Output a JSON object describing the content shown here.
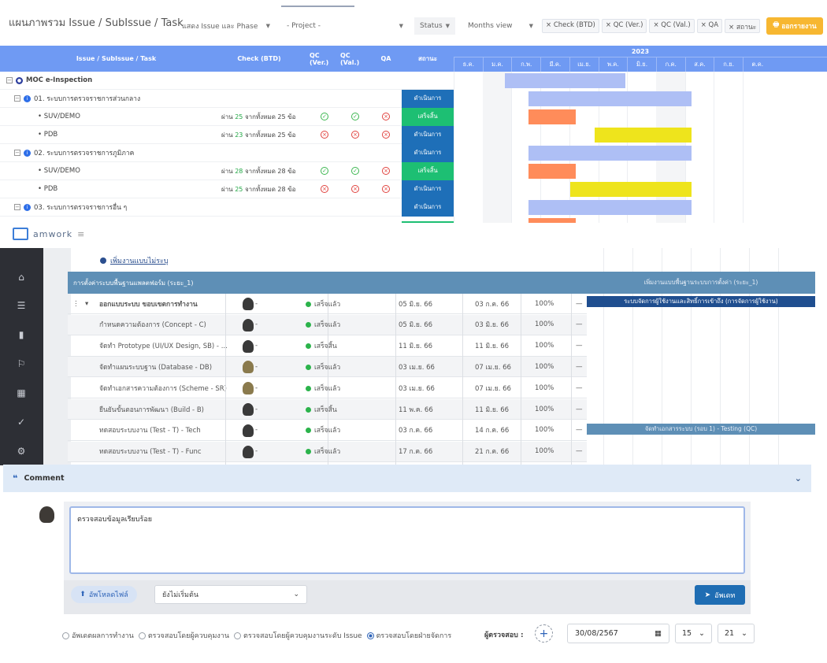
{
  "top": {
    "title": "แผนภาพรวม Issue / SubIssue / Task",
    "filters": {
      "display": "แสดง Issue และ Phase",
      "project": "- Project -",
      "status": "Status",
      "view": "Months view"
    },
    "chips": [
      "× Check (BTD)",
      "× QC (Ver.)",
      "× QC (Val.)",
      "× QA",
      "× สถานะ"
    ],
    "export_label": "ออกรายงาน",
    "columns": {
      "task": "Issue / SubIssue / Task",
      "check": "Check (BTD)",
      "qc_ver": "QC (Ver.)",
      "qc_val": "QC (Val.)",
      "qa": "QA",
      "status": "สถานะ"
    },
    "year": "2023",
    "months": [
      "ธ.ค.",
      "ม.ค.",
      "ก.พ.",
      "มี.ค.",
      "เม.ย.",
      "พ.ค.",
      "มิ.ย.",
      "ก.ค.",
      "ส.ค.",
      "ก.ย.",
      "ต.ค."
    ],
    "rows": [
      {
        "label": "MOC e-Inspection",
        "check": "",
        "status": ""
      },
      {
        "label": "01. ระบบการตรวจราชการส่วนกลาง",
        "check": "",
        "status": "ดำเนินการ"
      },
      {
        "label": "• SUV/DEMO",
        "check_pre": "ผ่าน",
        "check_num": "25",
        "check_post": "จากทั้งหมด 25 ข้อ",
        "status": "เสร็จสิ้น"
      },
      {
        "label": "• PDB",
        "check_pre": "ผ่าน",
        "check_num": "23",
        "check_post": "จากทั้งหมด 25 ข้อ",
        "status": "ดำเนินการ"
      },
      {
        "label": "02. ระบบการตรวจราชการภูมิภาค",
        "check": "",
        "status": "ดำเนินการ"
      },
      {
        "label": "• SUV/DEMO",
        "check_pre": "ผ่าน",
        "check_num": "28",
        "check_post": "จากทั้งหมด 28 ข้อ",
        "status": "เสร็จสิ้น"
      },
      {
        "label": "• PDB",
        "check_pre": "ผ่าน",
        "check_num": "25",
        "check_post": "จากทั้งหมด 28 ข้อ",
        "status": "ดำเนินการ"
      },
      {
        "label": "03. ระบบการตรวจราชการอื่น ๆ",
        "check": "",
        "status": "ดำเนินการ"
      }
    ]
  },
  "mid": {
    "logo": "amwork",
    "project_link": "เพิ่มงานแบบไม่ระบุ",
    "group_header": "การตั้งค่าระบบพื้นฐานแพลตฟอร์ม (ระยะ_1)",
    "gantt_bar_1": "เพิ่มงานแบบพื้นฐานระบบการตั้งค่า (ระยะ_1)",
    "gantt_bar_2": "ระบบจัดการผู้ใช้งานและสิทธิ์การเข้าถึง (การจัดการผู้ใช้งาน)",
    "gantt_bar_3": "จัดทำเอกสารระบบ (รอบ 1) - Testing (QC)",
    "rows": [
      {
        "name": "ออกแบบระบบ ขอบเขตการทำงาน",
        "status": "เสร็จแล้ว",
        "start": "05 มิ.ย. 66",
        "end": "03 ก.ค. 66",
        "pct": "100%"
      },
      {
        "name": "กำหนดความต้องการ (Concept - C)",
        "status": "เสร็จแล้ว",
        "start": "05 มิ.ย. 66",
        "end": "03 มิ.ย. 66",
        "pct": "100%"
      },
      {
        "name": "จัดทำ Prototype (UI/UX Design, SB) - ...",
        "status": "เสร็จสิ้น",
        "start": "11 มิ.ย. 66",
        "end": "11 มิ.ย. 66",
        "pct": "100%"
      },
      {
        "name": "จัดทำแผนระบบฐาน (Database - DB)",
        "status": "เสร็จแล้ว",
        "start": "03 เม.ย. 66",
        "end": "07 เม.ย. 66",
        "pct": "100%"
      },
      {
        "name": "จัดทำเอกสารความต้องการ (Scheme - SR)",
        "status": "เสร็จแล้ว",
        "start": "03 เม.ย. 66",
        "end": "07 เม.ย. 66",
        "pct": "100%"
      },
      {
        "name": "ยืนยันขั้นตอนการพัฒนา (Build - B)",
        "status": "เสร็จสิ้น",
        "start": "11 พ.ค. 66",
        "end": "11 มิ.ย. 66",
        "pct": "100%"
      },
      {
        "name": "ทดสอบระบบงาน (Test - T) - Tech",
        "status": "เสร็จแล้ว",
        "start": "03 ก.ค. 66",
        "end": "14 ก.ค. 66",
        "pct": "100%"
      },
      {
        "name": "ทดสอบระบบงาน (Test - T) - Func",
        "status": "เสร็จแล้ว",
        "start": "17 ก.ค. 66",
        "end": "21 ก.ค. 66",
        "pct": "100%"
      }
    ],
    "row_dash": "—",
    "row_person": "-"
  },
  "comment": {
    "header": "Comment",
    "text": "ตรวจสอบข้อมูลเรียบร้อย",
    "upload_label": "อัพโหลดไฟล์",
    "status_select": "ยังไม่เริ่มต้น",
    "update_label": "อัพเดท",
    "radios": [
      {
        "label": "อัพเดตผลการทำงาน",
        "checked": false
      },
      {
        "label": "ตรวจสอบโดยผู้ควบคุมงาน",
        "checked": false
      },
      {
        "label": "ตรวจสอบโดยผู้ควบคุมงานระดับ Issue",
        "checked": false
      },
      {
        "label": "ตรวจสอบโดยฝ่ายจัดการ",
        "checked": true
      }
    ],
    "inspector_label": "ผู้ตรวจสอบ :",
    "date": "30/08/2567",
    "hour": "15",
    "minute": "21"
  },
  "colors": {
    "header_blue": "#6f9af3",
    "status_progress": "#1e6fb8",
    "status_done": "#1dbf73",
    "bar_blue": "#aebff5",
    "bar_orange": "#ff8c5a",
    "bar_yellow": "#eee41c",
    "accent_export": "#f7b731"
  }
}
